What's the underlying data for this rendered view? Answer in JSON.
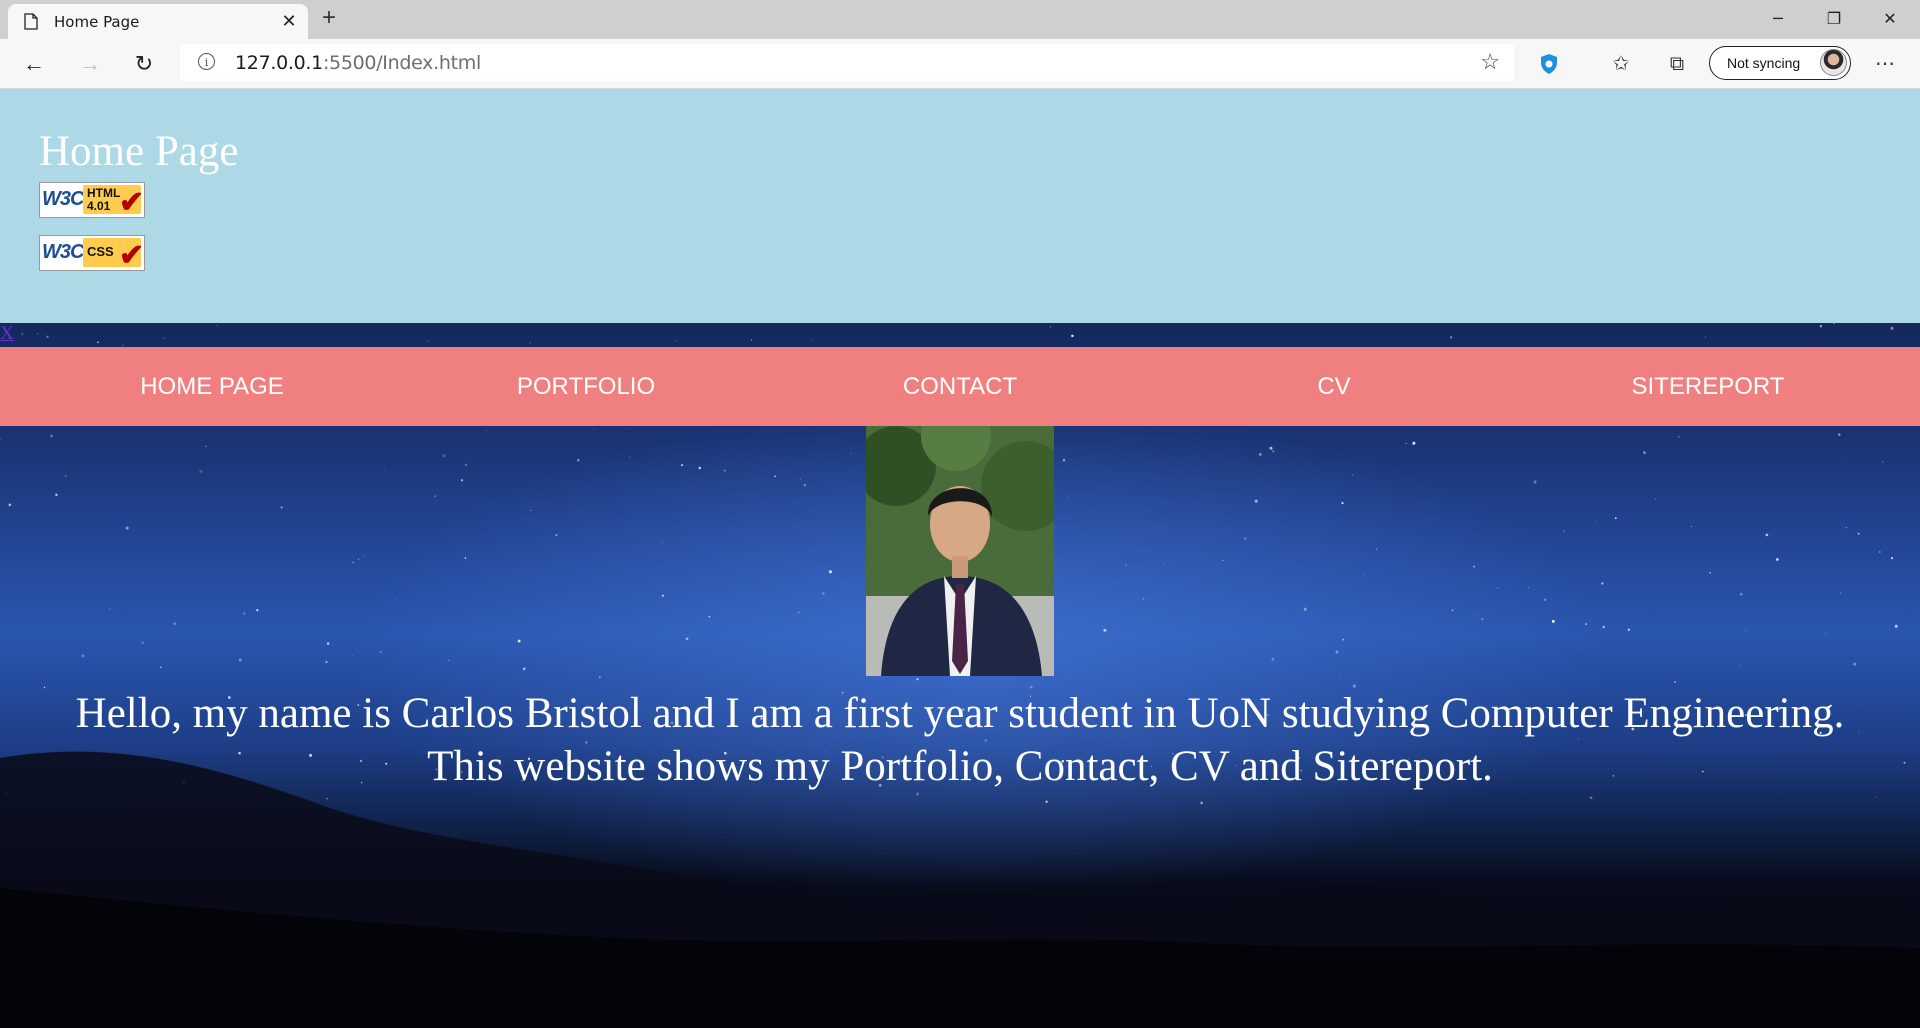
{
  "browser": {
    "tab_title": "Home Page",
    "url_host": "127.0.0.1",
    "url_rest": ":5500/Index.html",
    "sync_label": "Not syncing"
  },
  "page": {
    "heading": "Home Page",
    "badges": [
      {
        "logo": "W3C",
        "tag_line1": "HTML",
        "tag_line2": "4.01"
      },
      {
        "logo": "W3C",
        "tag_line1": "CSS",
        "tag_line2": ""
      }
    ],
    "close_link": "X",
    "nav": [
      "HOME PAGE",
      "PORTFOLIO",
      "CONTACT",
      "CV",
      "SITEREPORT"
    ],
    "intro_line1": "Hello, my name is Carlos Bristol and I am a first year student in UoN studying Computer Engineering.",
    "intro_line2": "This website shows my Portfolio, Contact, CV and Sitereport.",
    "colors": {
      "header_bg": "#add8e6",
      "nav_bg": "#f08080",
      "link": "#6b2fd6"
    }
  }
}
